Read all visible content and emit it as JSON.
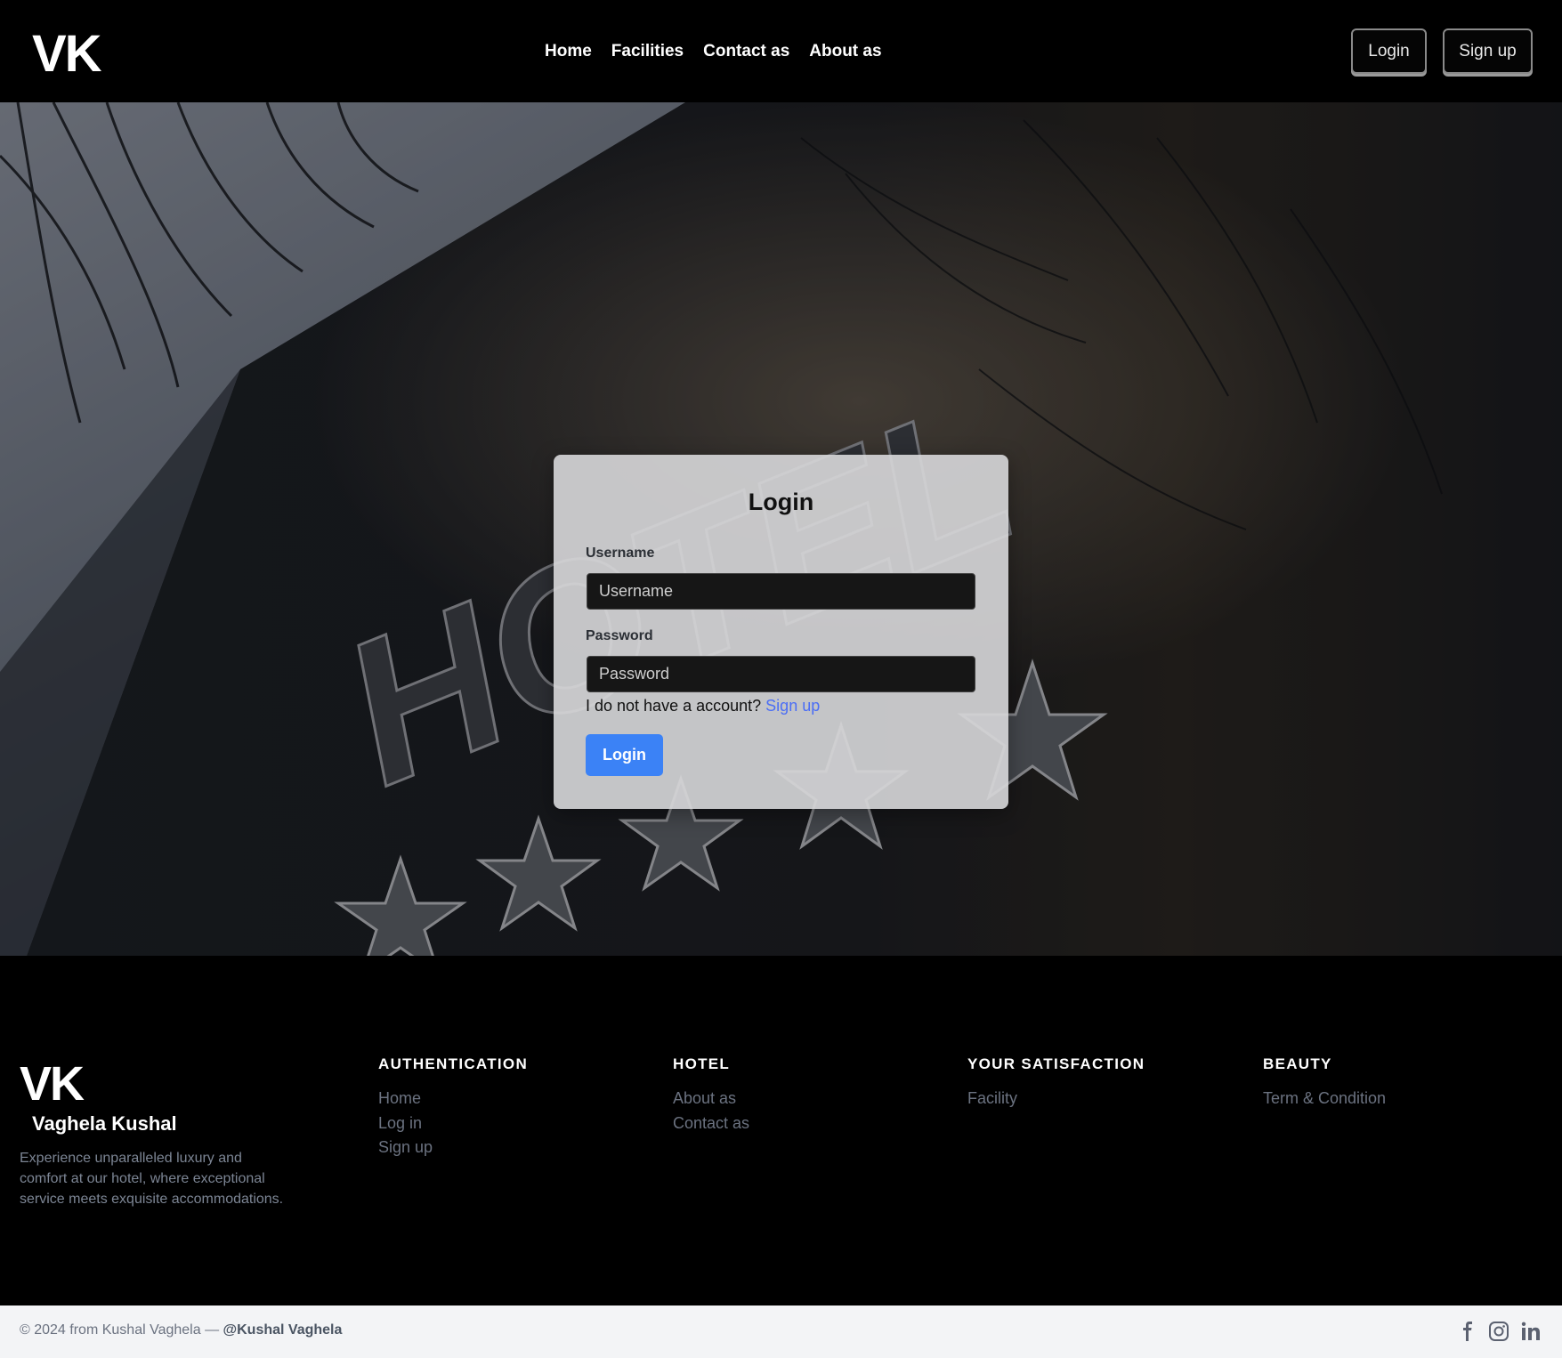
{
  "nav": {
    "brand": "VK",
    "links": [
      "Home",
      "Facilities",
      "Contact as",
      "About as"
    ],
    "login_label": "Login",
    "signup_label": "Sign up"
  },
  "login_form": {
    "title": "Login",
    "username_label": "Username",
    "username_placeholder": "Username",
    "username_value": "",
    "password_label": "Password",
    "password_placeholder": "Password",
    "password_value": "",
    "no_account_text": "I do not have a account?",
    "signup_link": "Sign up",
    "submit_label": "Login"
  },
  "hero": {
    "sign_text": "HOTEL",
    "star_count": 5,
    "icons": [
      "palm-leaves",
      "star"
    ]
  },
  "footer": {
    "brand": "VK",
    "name": "Vaghela Kushal",
    "description": "Experience unparalleled luxury and comfort at our hotel, where exceptional service meets exquisite accommodations.",
    "columns": [
      {
        "title": "AUTHENTICATION",
        "links": [
          "Home",
          "Log in",
          "Sign up"
        ]
      },
      {
        "title": "HOTEL",
        "links": [
          "About as",
          "Contact as"
        ]
      },
      {
        "title": "YOUR SATISFACTION",
        "links": [
          "Facility"
        ]
      },
      {
        "title": "BEAUTY",
        "links": [
          "Term & Condition"
        ]
      }
    ]
  },
  "bottom_bar": {
    "copyright": "© 2024 from Kushal Vaghela — ",
    "handle": "@Kushal Vaghela",
    "social_icons": [
      "facebook-icon",
      "instagram-icon",
      "linkedin-icon"
    ]
  },
  "colors": {
    "accent": "#3b82f6",
    "link": "#4b6ef5",
    "background": "#000000",
    "footer_link": "#6b7280",
    "bottom_bar": "#f3f4f6"
  }
}
